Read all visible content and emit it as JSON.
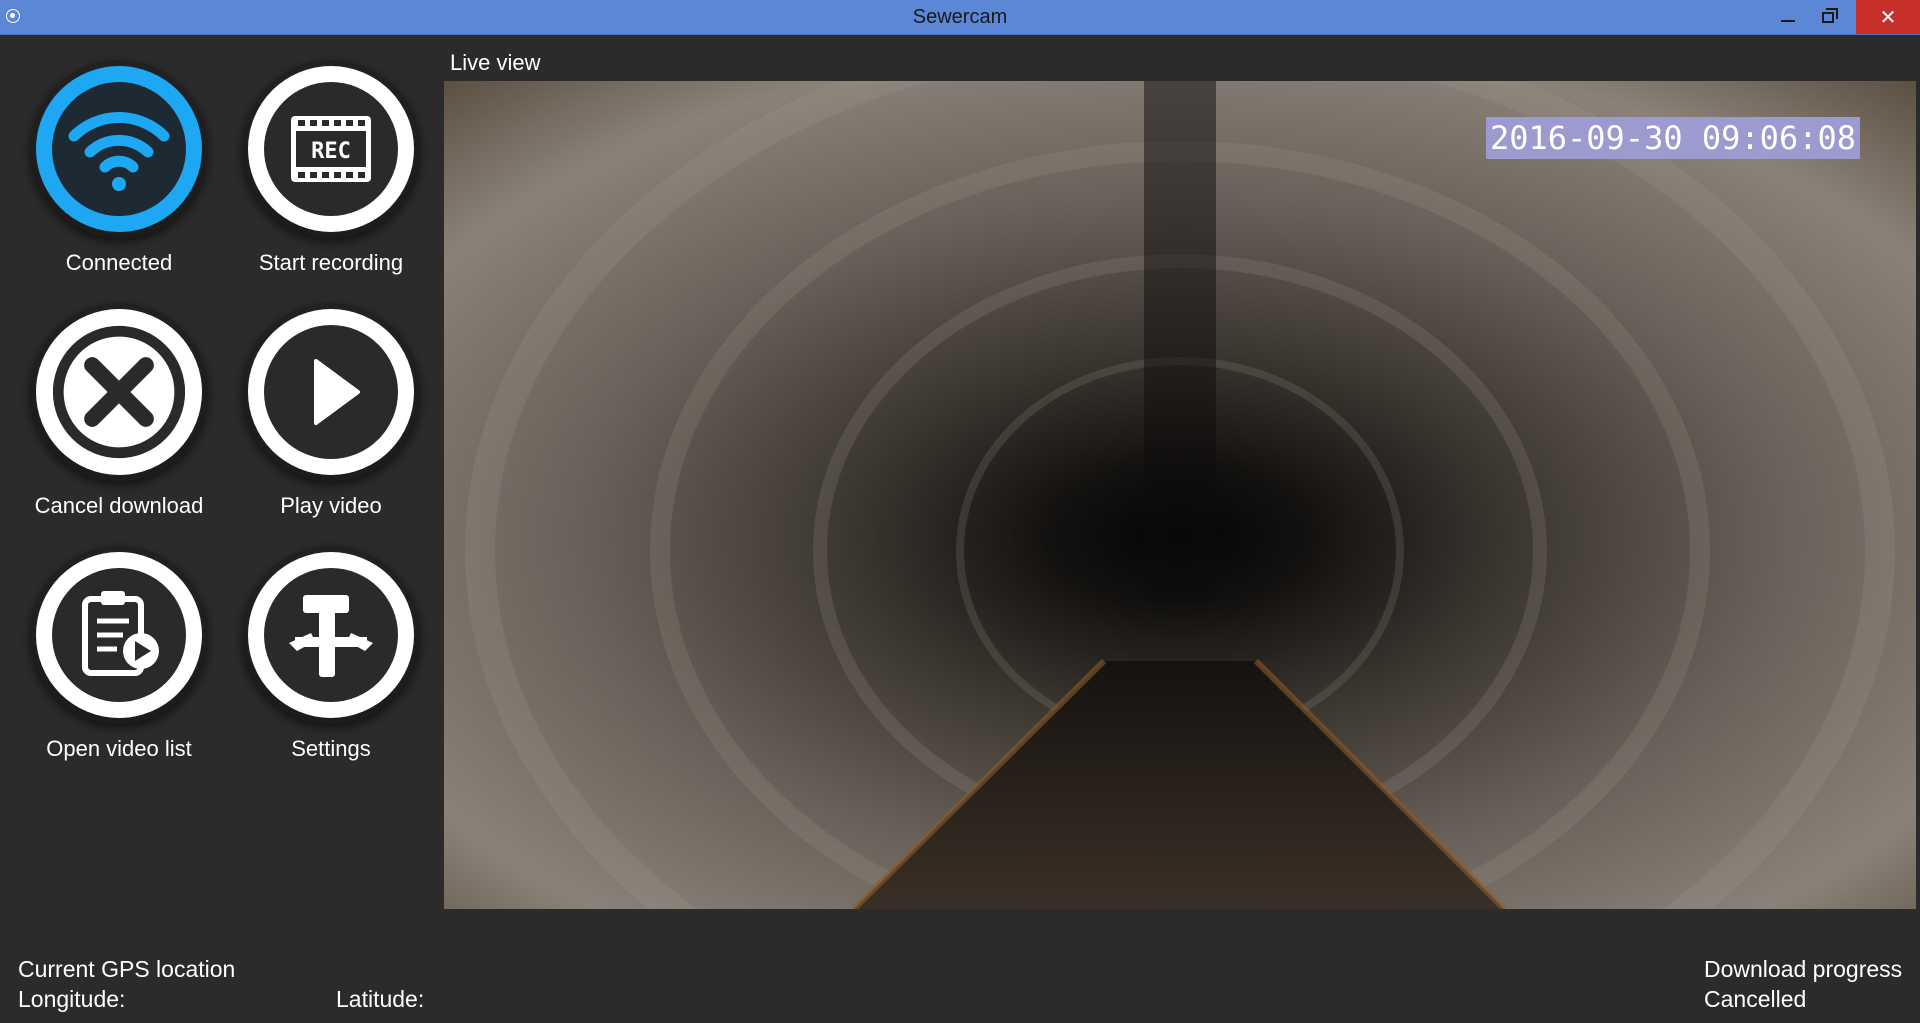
{
  "window": {
    "title": "Sewercam",
    "close_glyph": "✕"
  },
  "buttons": [
    {
      "label": "Connected",
      "icon": "wifi-icon"
    },
    {
      "label": "Start recording",
      "icon": "rec-icon"
    },
    {
      "label": "Cancel download",
      "icon": "cancel-icon"
    },
    {
      "label": "Play video",
      "icon": "play-icon"
    },
    {
      "label": "Open video list",
      "icon": "video-list-icon"
    },
    {
      "label": "Settings",
      "icon": "settings-icon"
    }
  ],
  "rec_badge": "REC",
  "live": {
    "label": "Live view",
    "timestamp": "2016-09-30 09:06:08"
  },
  "gps": {
    "heading": "Current GPS location",
    "longitude_label": "Longitude:",
    "latitude_label": "Latitude:"
  },
  "download": {
    "heading": "Download progress",
    "status": "Cancelled"
  },
  "colors": {
    "titlebar": "#5b87d6",
    "accent_blue": "#1ea7f2",
    "close": "#c7302a",
    "background": "#2b2b2b"
  }
}
